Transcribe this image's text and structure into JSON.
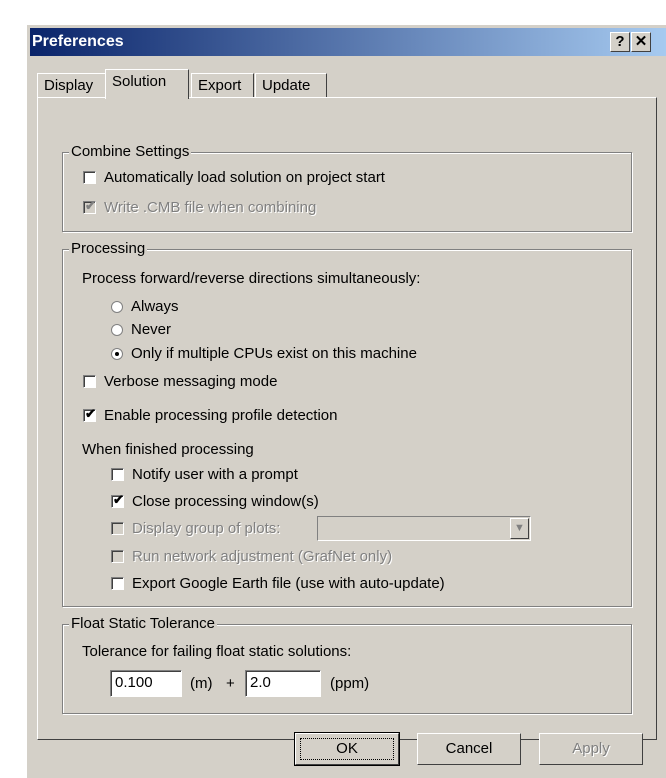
{
  "window": {
    "title": "Preferences",
    "help_button": "?",
    "close_button": "✕"
  },
  "tabs": [
    {
      "label": "Display",
      "active": false
    },
    {
      "label": "Solution",
      "active": true
    },
    {
      "label": "Export",
      "active": false
    },
    {
      "label": "Update",
      "active": false
    }
  ],
  "combine": {
    "title": "Combine Settings",
    "auto_load": {
      "label": "Automatically load solution on project start",
      "checked": false,
      "enabled": true
    },
    "write_cmb": {
      "label": "Write .CMB file when combining",
      "checked": true,
      "enabled": false
    }
  },
  "processing": {
    "title": "Processing",
    "direction_label": "Process forward/reverse directions simultaneously:",
    "radio_always": "Always",
    "radio_never": "Never",
    "radio_multi": "Only if multiple CPUs exist on this machine",
    "selected_radio": "Only if multiple CPUs exist on this machine",
    "verbose": {
      "label": "Verbose messaging mode",
      "checked": false
    },
    "profile": {
      "label": "Enable processing profile detection",
      "checked": true
    },
    "finished_label": "When finished processing",
    "notify": {
      "label": "Notify user with a prompt",
      "checked": false
    },
    "close_window": {
      "label": "Close processing window(s)",
      "checked": true
    },
    "display_plots": {
      "label": "Display group of plots:",
      "checked": false,
      "enabled": false,
      "value": ""
    },
    "run_network": {
      "label": "Run network adjustment (GrafNet only)",
      "checked": false,
      "enabled": false
    },
    "export_ge": {
      "label": "Export Google Earth file (use with auto-update)",
      "checked": false
    }
  },
  "float_static": {
    "title": "Float Static Tolerance",
    "description": "Tolerance for failing float static solutions:",
    "value_m": "0.100",
    "unit_m": "(m)",
    "plus": "+",
    "value_ppm": "2.0",
    "unit_ppm": "(ppm)"
  },
  "buttons": {
    "ok": "OK",
    "cancel": "Cancel",
    "apply": "Apply"
  },
  "icons": {
    "check": "✔"
  }
}
